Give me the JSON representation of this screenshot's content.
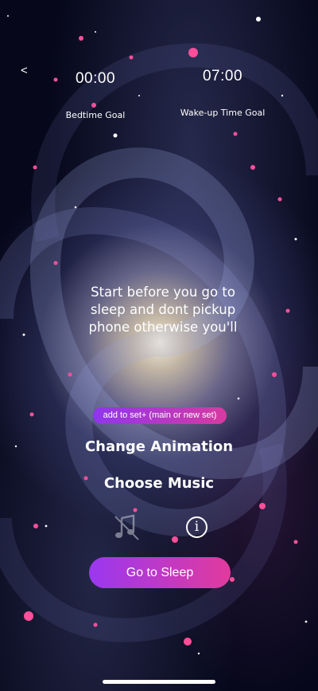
{
  "nav": {
    "back_label": "<"
  },
  "times": {
    "bedtime": {
      "value": "00:00",
      "label": "Bedtime Goal"
    },
    "wakeup": {
      "value": "07:00",
      "label": "Wake-up Time Goal"
    }
  },
  "main": {
    "message": "Start before you go to sleep and dont pickup phone otherwise you'll"
  },
  "actions": {
    "add_to_set_label": "add to set+ (main or new set)",
    "change_animation_label": "Change Animation",
    "choose_music_label": "Choose Music",
    "info_glyph": "i",
    "go_to_sleep_label": "Go to Sleep"
  },
  "icons": {
    "music": "music-note-icon",
    "info": "info-icon"
  },
  "colors": {
    "accent_start": "#9a38f0",
    "accent_end": "#e13a9d",
    "text": "#ffffff",
    "background": "#06071a"
  }
}
